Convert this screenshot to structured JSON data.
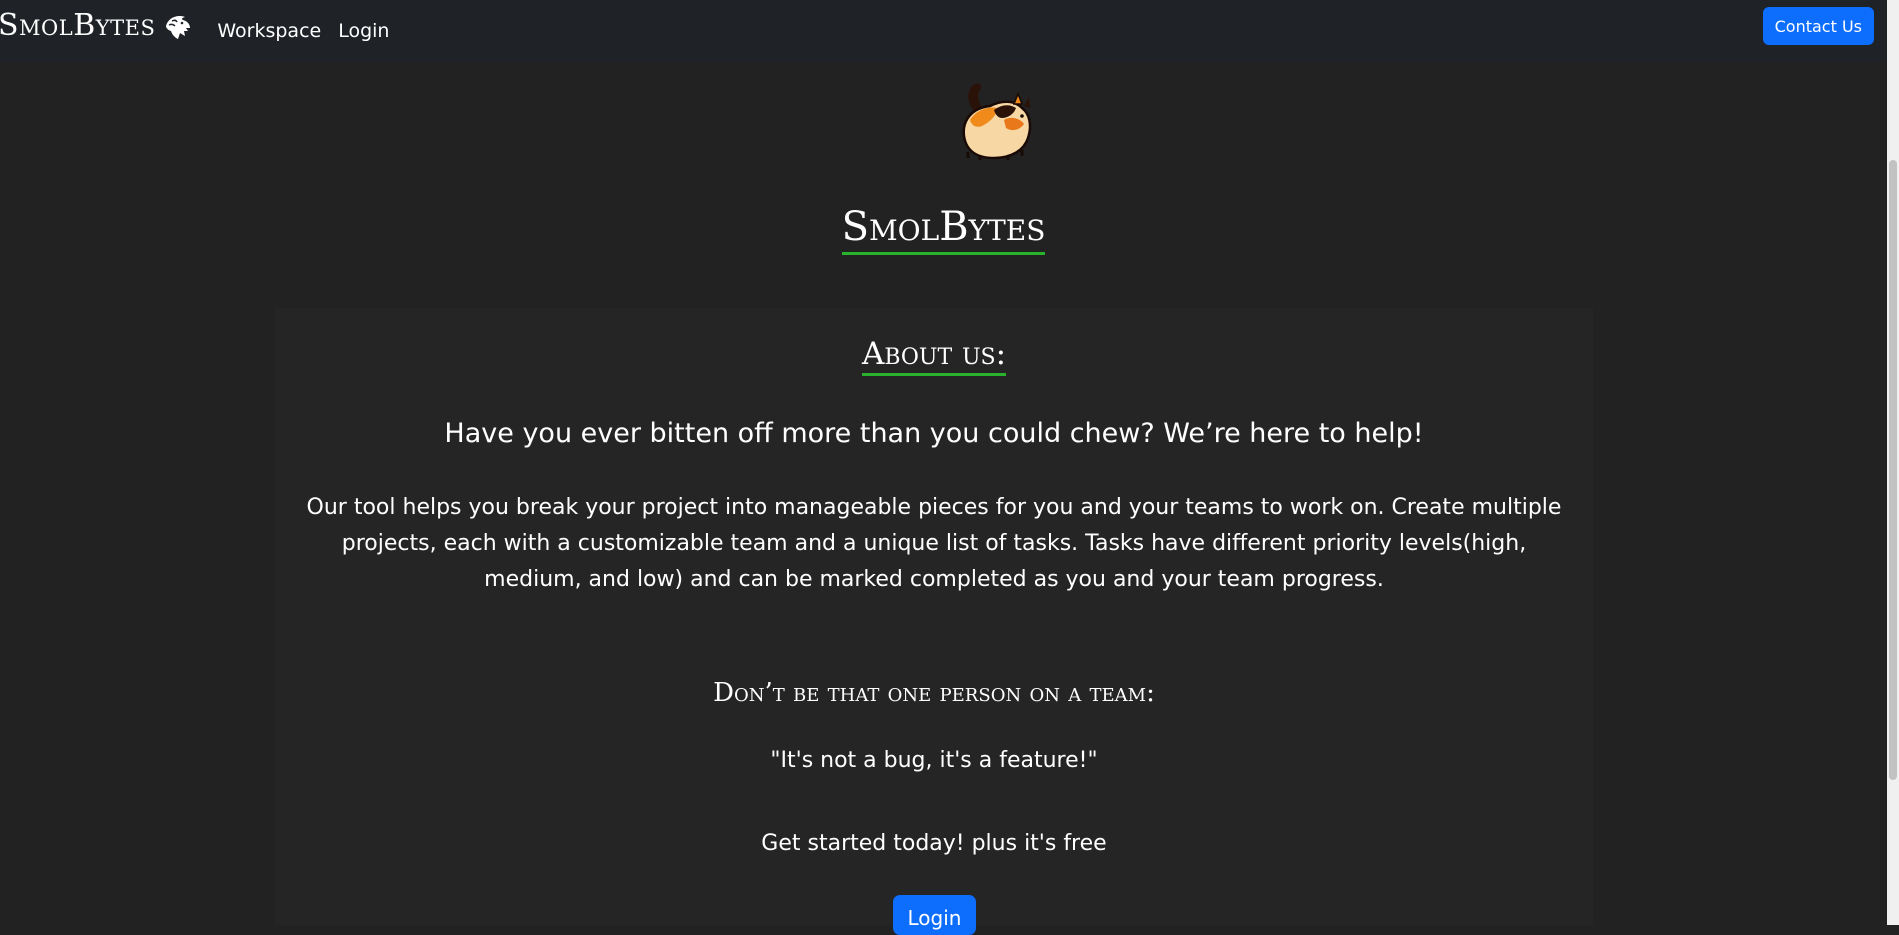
{
  "navbar": {
    "brand": "SmolBytes",
    "logo_icon": "lion-head-icon",
    "links": [
      "Workspace",
      "Login"
    ],
    "contact_label": "Contact Us"
  },
  "hero": {
    "image_icon": "cat-mascot-icon",
    "title": "SmolBytes"
  },
  "about": {
    "title": "About us:",
    "tagline": "Have you ever bitten off more than you could chew? We’re here to help!",
    "description": "Our tool helps you break your project into manageable pieces for you and your teams to work on. Create multiple projects, each with a customizable team and a unique list of tasks. Tasks have different priority levels(high, medium, and low) and can be marked completed as you and your team progress.",
    "subheading": "Don’t be that one person on a team:",
    "quote": "\"It's not a bug, it's a feature!\"",
    "cta": "Get started today! plus it's free",
    "login_label": "Login"
  },
  "colors": {
    "background": "#222222",
    "navbar": "#1f2327",
    "panel": "#252525",
    "accent_underline": "#29b32c",
    "button": "#0d6efd"
  }
}
